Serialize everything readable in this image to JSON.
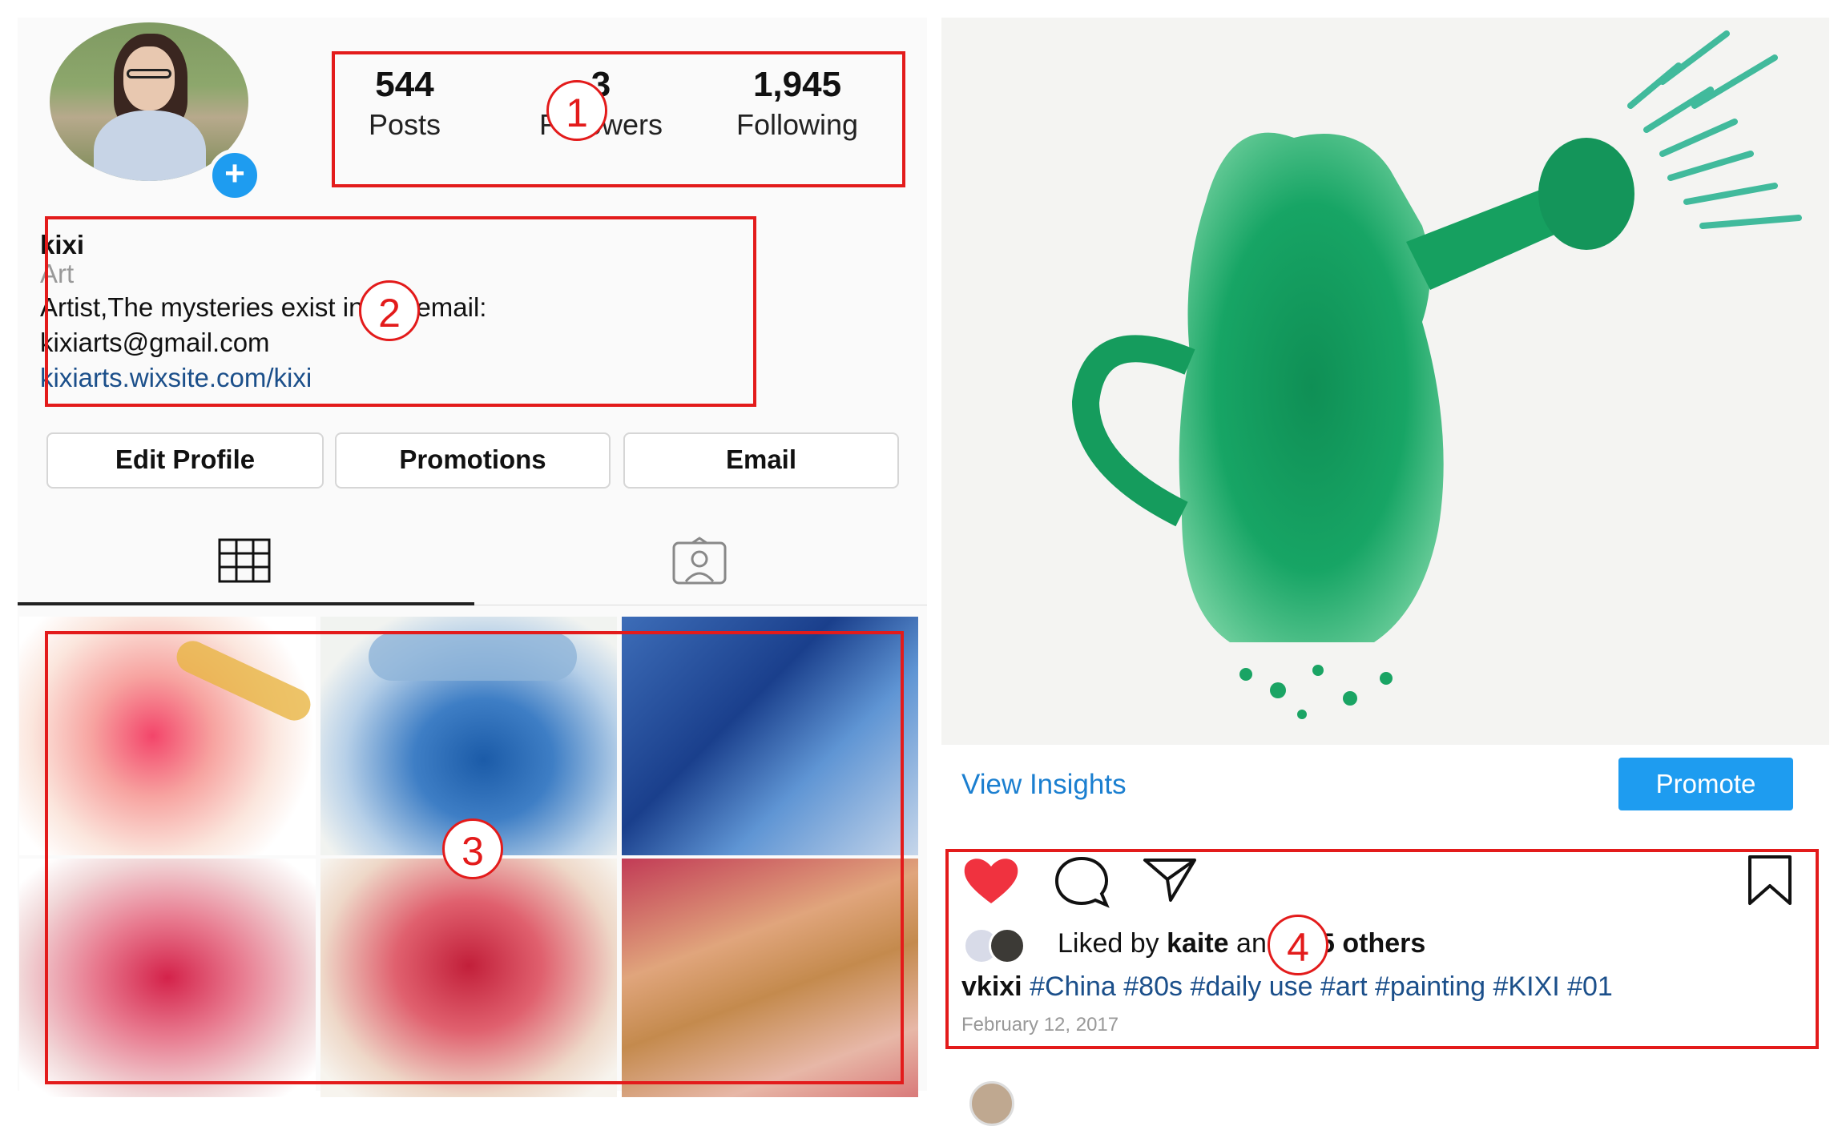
{
  "profile": {
    "stats": [
      {
        "value": "544",
        "label": "Posts"
      },
      {
        "value": "3",
        "label": "Followers"
      },
      {
        "value": "1,945",
        "label": "Following"
      }
    ],
    "name": "kixi",
    "category": "Art",
    "bio_line1": "Artist,The mysteries exist in art. email:",
    "bio_line2": "kixiarts@gmail.com",
    "link": "kixiarts.wixsite.com/kixi",
    "buttons": {
      "edit": "Edit Profile",
      "promotions": "Promotions",
      "email": "Email"
    }
  },
  "post": {
    "view_insights": "View Insights",
    "promote": "Promote",
    "liked_by_prefix": "Liked by ",
    "liked_by_user": "kaite",
    "liked_by_suffix": "155 others",
    "caption_user": "vkixi",
    "caption_tags": "#China #80s #daily use #art #painting #KIXI #01",
    "date": "February 12, 2017"
  },
  "annotations": [
    "1",
    "2",
    "3",
    "4"
  ],
  "colors": {
    "accent": "#1e9cf0",
    "annotation": "#e31b1b",
    "like": "#f0323f",
    "link": "#1b4f8a"
  }
}
